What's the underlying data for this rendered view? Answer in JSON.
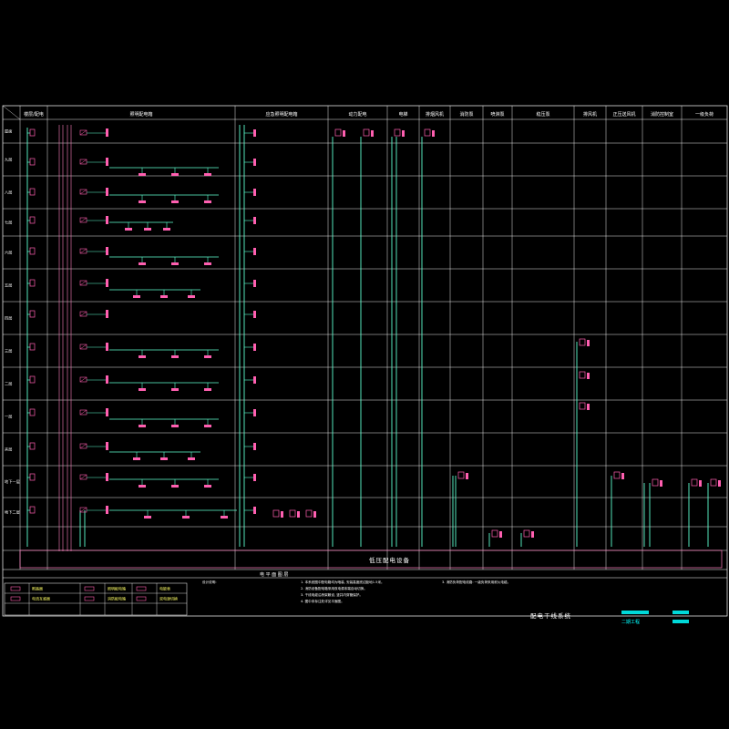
{
  "sheet": {
    "title": "配电干线系统",
    "project": "二期工程",
    "section_label": "电 平 面 图 层",
    "device_label": "低压配电设备"
  },
  "headers": [
    "楼层/配电",
    "照明配电箱",
    "应急照明配电箱",
    "动力配电",
    "电梯",
    "排烟风机",
    "消防泵",
    "喷淋泵",
    "稳压泵",
    "排风机",
    "正压送风机",
    "消防控制室",
    "一级负荷"
  ],
  "floors": [
    "屋面",
    "九层",
    "八层",
    "七层",
    "六层",
    "五层",
    "四层",
    "三层",
    "二层",
    "一层",
    "夹层",
    "地下一层",
    "地下二层"
  ],
  "legend": {
    "items": [
      {
        "symbol": "breaker",
        "label": "断路器",
        "color": "#ff5fb0"
      },
      {
        "symbol": "box",
        "label": "照明配电箱",
        "color": "#ff5fb0"
      },
      {
        "symbol": "dot",
        "label": "电能表",
        "color": "#ff5fb0"
      },
      {
        "symbol": "meter",
        "label": "电流互感器",
        "color": "#ff5fb0"
      },
      {
        "symbol": "bar",
        "label": "消防配电箱",
        "color": "#ff5fb0"
      },
      {
        "symbol": "cross",
        "label": "双电源切换",
        "color": "#ff5fb0"
      }
    ]
  },
  "notes": {
    "heading": "设计说明:",
    "lines": [
      "1. 本系统图中配电箱均为暗装, 安装高度底边距地1.5米。",
      "2. 消防设备配电箱采用双电源末端自动切换。",
      "3. 干线电缆沿桥架敷设, 竖井内穿管保护。",
      "4. 图中未标注处详见平面图。"
    ],
    "side": "3. 消防负荷配电线路: 一级负荷采用耐火电缆。"
  },
  "colors": {
    "grid": "#ffffff",
    "feeder": "#5fffd0",
    "device": "#ff5fb0",
    "label": "#ffff66",
    "title_accent": "#00ffff"
  }
}
